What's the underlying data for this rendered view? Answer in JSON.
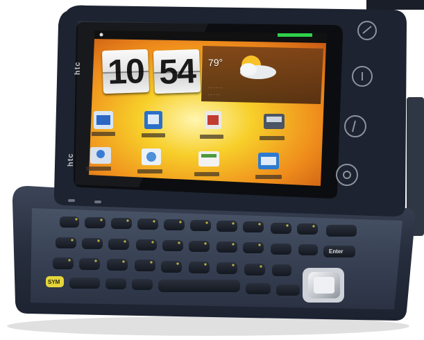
{
  "photo": {
    "subject": "slider-phone",
    "colors": {
      "body": "#2a3244",
      "bezel": "#0c0d10",
      "screen_orange": "#e8781c",
      "screen_yellow": "#f6c21d",
      "keyboard": "#3b4458",
      "key_yellow": "#e5d53a"
    }
  },
  "screen": {
    "clock": {
      "hour": "10",
      "minute": "54"
    },
    "weather": {
      "temperature": "79°",
      "icon": "partly-cloudy-icon"
    },
    "app_icons": [
      "mail-icon",
      "photos-icon",
      "store-icon",
      "messages-icon",
      "people-icon",
      "settings-icon",
      "calendar-icon",
      "browser-icon"
    ]
  },
  "hardware": {
    "brand": "htc",
    "brand_top": "htc",
    "nav_buttons": [
      "home-icon",
      "menu-icon",
      "back-icon",
      "search-icon"
    ]
  },
  "keyboard": {
    "sym_key": "SYM",
    "enter_key": "Enter"
  }
}
